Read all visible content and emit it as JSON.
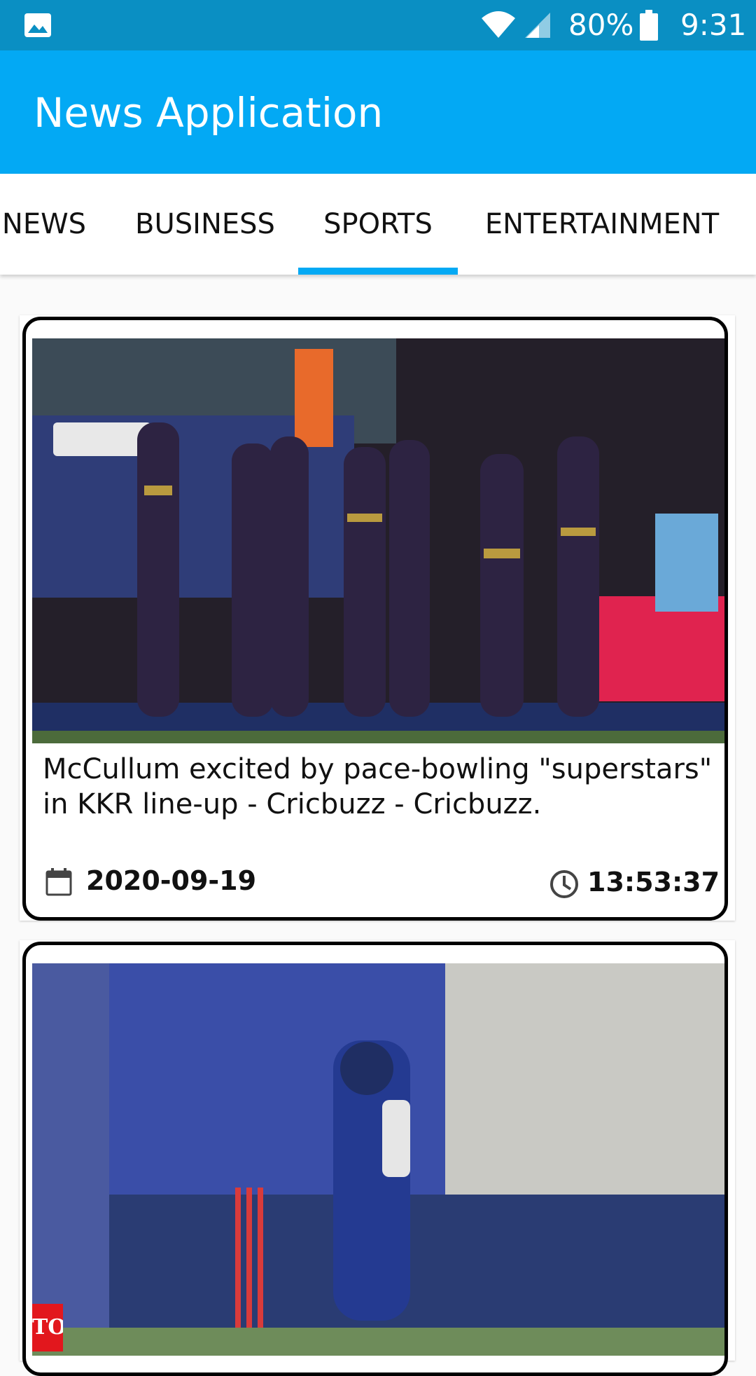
{
  "status_bar": {
    "battery": "80%",
    "time": "9:31",
    "icons": [
      "image-icon",
      "wifi-icon",
      "signal-icon",
      "battery-icon"
    ]
  },
  "app_bar": {
    "title": "News Application",
    "color": "#03a9f4"
  },
  "tabs": {
    "items": [
      {
        "label": "NEWS"
      },
      {
        "label": "BUSINESS"
      },
      {
        "label": "SPORTS"
      },
      {
        "label": "ENTERTAINMENT"
      }
    ],
    "selected": "SPORTS",
    "indicator_color": "#03a9f4"
  },
  "articles": [
    {
      "image": "photo of KKR cricket players celebrating on field",
      "headline": "McCullum excited by pace-bowling \"superstars\" in KKR line-up - Cricbuzz - Cricbuzz.",
      "date": "2020-09-19",
      "time": "13:53:37"
    },
    {
      "image": "photo of Mumbai Indians batsman playing a shot",
      "badge": "TOI"
    }
  ]
}
